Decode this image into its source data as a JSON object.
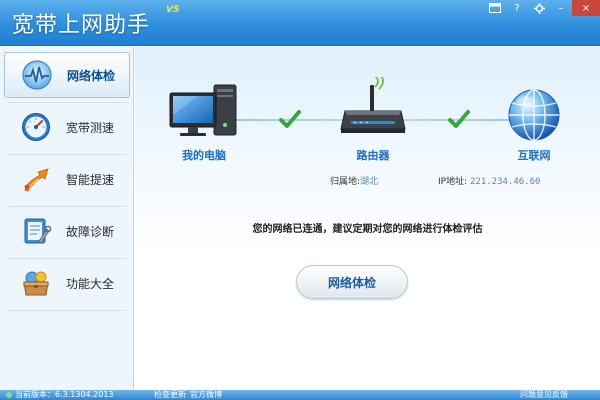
{
  "app": {
    "title": "宽带上网助手",
    "version": "V5"
  },
  "window_controls": {
    "menu_icon": "window-menu-icon",
    "help": "?",
    "settings_icon": "gear-icon",
    "minimize": "–",
    "close": "×"
  },
  "sidebar": {
    "items": [
      {
        "label": "网络体检",
        "icon": "heartbeat-monitor-icon",
        "active": true
      },
      {
        "label": "宽带测速",
        "icon": "speedometer-icon",
        "active": false
      },
      {
        "label": "智能提速",
        "icon": "rocket-arrow-icon",
        "active": false
      },
      {
        "label": "故障诊断",
        "icon": "diagnostic-tools-icon",
        "active": false
      },
      {
        "label": "功能大全",
        "icon": "toolbox-icon",
        "active": false
      }
    ]
  },
  "topology": {
    "devices": [
      {
        "label": "我的电脑",
        "icon": "computer-icon"
      },
      {
        "label": "路由器",
        "icon": "router-icon"
      },
      {
        "label": "互联网",
        "icon": "internet-globe-icon"
      }
    ],
    "links_ok": [
      true,
      true
    ],
    "location_label": "归属地:",
    "location_value": "湖北",
    "ip_label": "IP地址:",
    "ip_value": "221.234.46.60"
  },
  "status_message": "您的网络已连通，建议定期对您的网络进行体检评估",
  "check_button_label": "网络体检",
  "statusbar": {
    "version_label": "当前版本：6.3.1304.2013",
    "check_update": "检查更新",
    "official_weibo": "官方微博",
    "feedback": "问题意见反馈"
  },
  "colors": {
    "titlebar": "#2f8fdc",
    "accent_text": "#1b6fc2",
    "check_green": "#3aa63a"
  }
}
